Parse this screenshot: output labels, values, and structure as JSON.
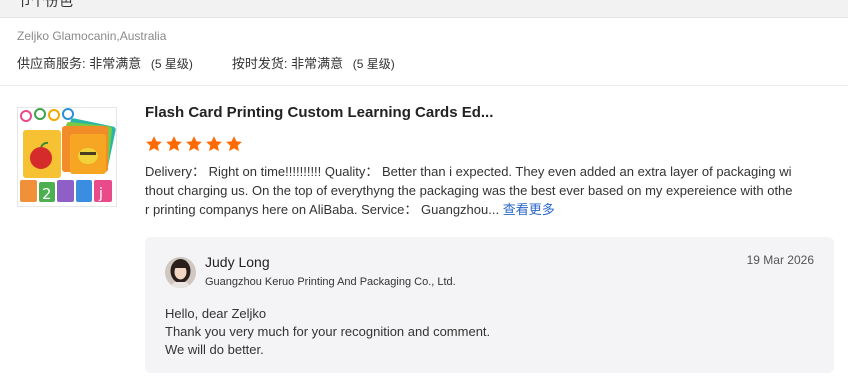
{
  "header": {
    "cut_text": "节个份色"
  },
  "review": {
    "reviewer": "Zeljko Glamocanin,Australia",
    "ratings": [
      {
        "label": "供应商服务:",
        "value": "非常满意",
        "level": "(5 星级)"
      },
      {
        "label": "按时发货:",
        "value": "非常满意",
        "level": "(5 星级)"
      }
    ],
    "product_title": "Flash Card Printing Custom Learning Cards Ed...",
    "stars": 5,
    "star_color": "#ff6a00",
    "text": "Delivery： Right on time!!!!!!!!!! Quality： Better than i expected. They even added an extra layer of packaging without charging us. On the top of everythyng the packaging was the best ever based on my expereience with other printing companys here on AliBaba. Service： Guangzhou...",
    "more_label": "查看更多"
  },
  "reply": {
    "name": "Judy Long",
    "company": "Guangzhou Keruo Printing And Packaging Co., Ltd.",
    "date": "19 Mar 2026",
    "lines": [
      "Hello, dear Zeljko",
      "Thank you very much for your recognition and comment.",
      "We will do better."
    ]
  }
}
